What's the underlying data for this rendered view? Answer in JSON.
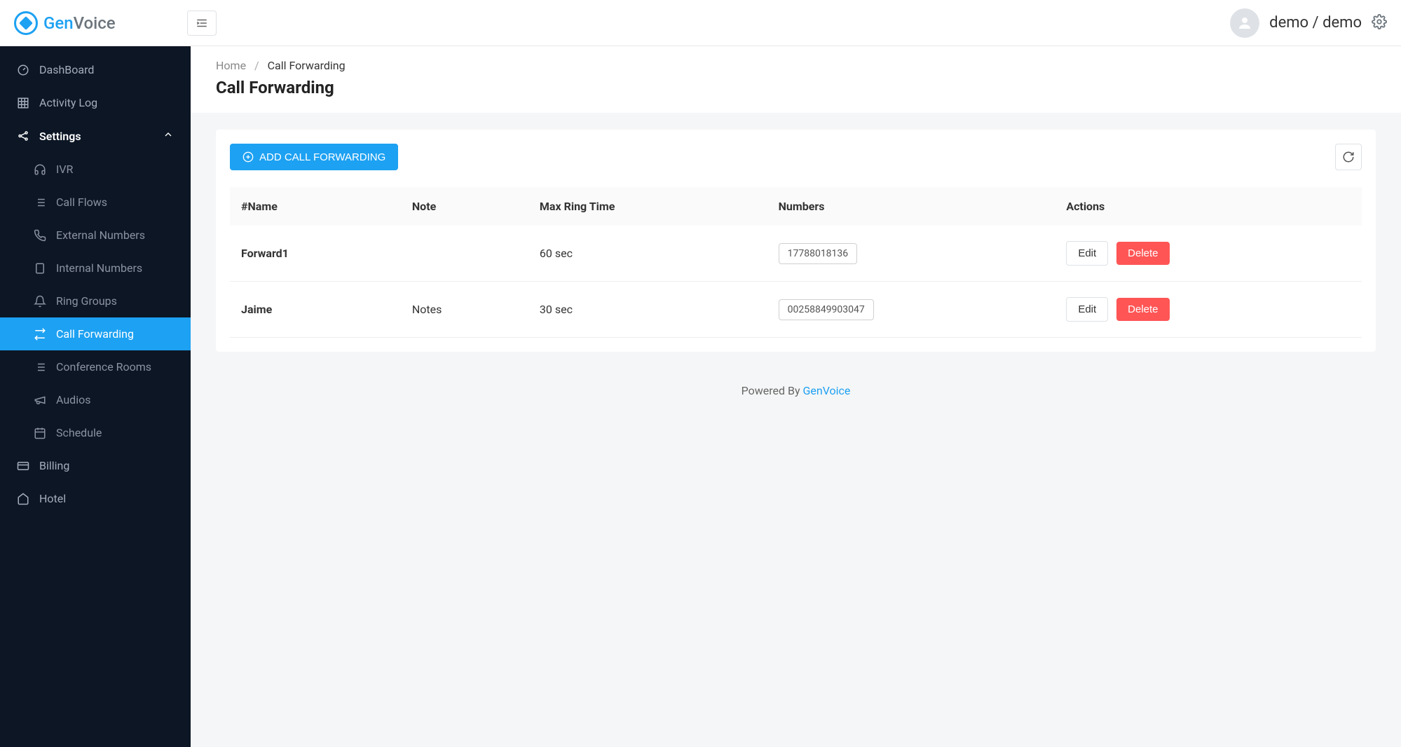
{
  "brand": {
    "gen": "Gen",
    "voice": "Voice"
  },
  "header": {
    "user_name": "demo / demo"
  },
  "sidebar": {
    "dashboard": "DashBoard",
    "activity_log": "Activity Log",
    "settings": "Settings",
    "ivr": "IVR",
    "call_flows": "Call Flows",
    "external_numbers": "External Numbers",
    "internal_numbers": "Internal Numbers",
    "ring_groups": "Ring Groups",
    "call_forwarding": "Call Forwarding",
    "conference_rooms": "Conference Rooms",
    "audios": "Audios",
    "schedule": "Schedule",
    "billing": "Billing",
    "hotel": "Hotel"
  },
  "breadcrumb": {
    "home": "Home",
    "current": "Call Forwarding"
  },
  "page_title": "Call Forwarding",
  "actions": {
    "add_label": "ADD CALL FORWARDING",
    "edit": "Edit",
    "delete": "Delete"
  },
  "table": {
    "headers": {
      "name": "#Name",
      "note": "Note",
      "max_ring_time": "Max Ring Time",
      "numbers": "Numbers",
      "actions": "Actions"
    },
    "rows": [
      {
        "name": "Forward1",
        "note": "",
        "max_ring_time": "60 sec",
        "number": "17788018136"
      },
      {
        "name": "Jaime",
        "note": "Notes",
        "max_ring_time": "30 sec",
        "number": "00258849903047"
      }
    ]
  },
  "footer": {
    "powered_by": "Powered By ",
    "brand": "GenVoice"
  }
}
